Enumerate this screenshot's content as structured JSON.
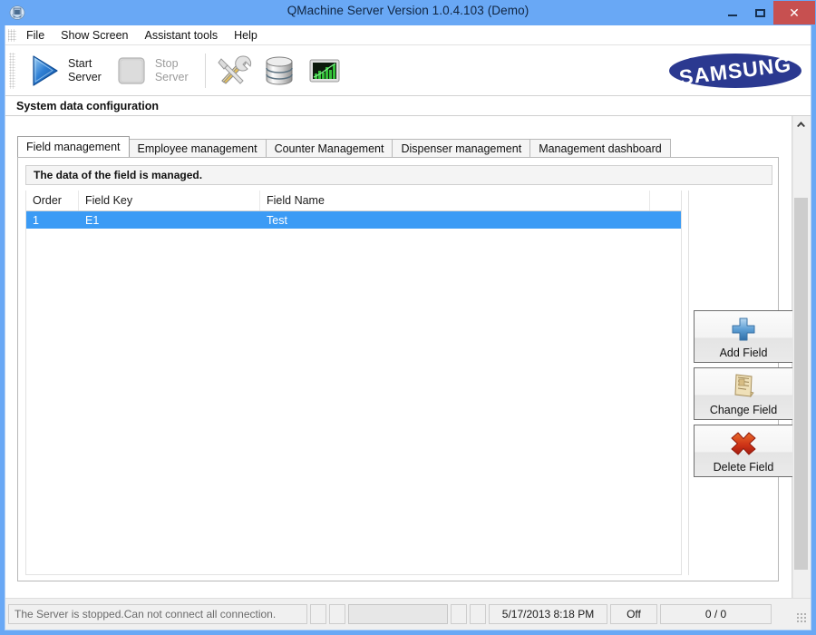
{
  "window": {
    "title": "QMachine Server Version 1.0.4.103 (Demo)",
    "icon": "app-window-icon",
    "minimize_label": "",
    "maximize_label": "",
    "close_label": "✕"
  },
  "menu": {
    "items": [
      {
        "label": "File"
      },
      {
        "label": "Show Screen"
      },
      {
        "label": "Assistant tools"
      },
      {
        "label": "Help"
      }
    ]
  },
  "toolbar": {
    "start_server": {
      "label": "Start\nServer",
      "icon": "play-triangle-icon",
      "enabled": true
    },
    "stop_server": {
      "label": "Stop\nServer",
      "icon": "stop-square-icon",
      "enabled": false
    },
    "icons": [
      {
        "name": "tools-icon"
      },
      {
        "name": "database-icon"
      },
      {
        "name": "chart-icon"
      }
    ],
    "brand": "SAMSUNG"
  },
  "section": {
    "title": "System data configuration"
  },
  "tabs": [
    {
      "label": "Field management",
      "active": true
    },
    {
      "label": "Employee management",
      "active": false
    },
    {
      "label": "Counter Management",
      "active": false
    },
    {
      "label": "Dispenser management",
      "active": false
    },
    {
      "label": "Management dashboard",
      "active": false
    }
  ],
  "panel": {
    "description": "The data of the field is managed.",
    "grid": {
      "columns": [
        "Order",
        "Field Key",
        "Field Name"
      ],
      "rows": [
        {
          "order": "1",
          "field_key": "E1",
          "field_name": "Test",
          "selected": true
        }
      ]
    },
    "buttons": [
      {
        "label": "Add Field",
        "icon": "plus-icon"
      },
      {
        "label": "Change Field",
        "icon": "document-edit-icon"
      },
      {
        "label": "Delete Field",
        "icon": "red-x-icon"
      }
    ]
  },
  "statusbar": {
    "message": "The Server is stopped.Can not connect all connection.",
    "date": "5/17/2013 8:18 PM",
    "mode": "Off",
    "count": "0 / 0"
  },
  "colors": {
    "titlebar": "#69a8f5",
    "selection": "#3b9bf5",
    "close_button": "#c75050",
    "samsung_blue": "#2b3990"
  }
}
